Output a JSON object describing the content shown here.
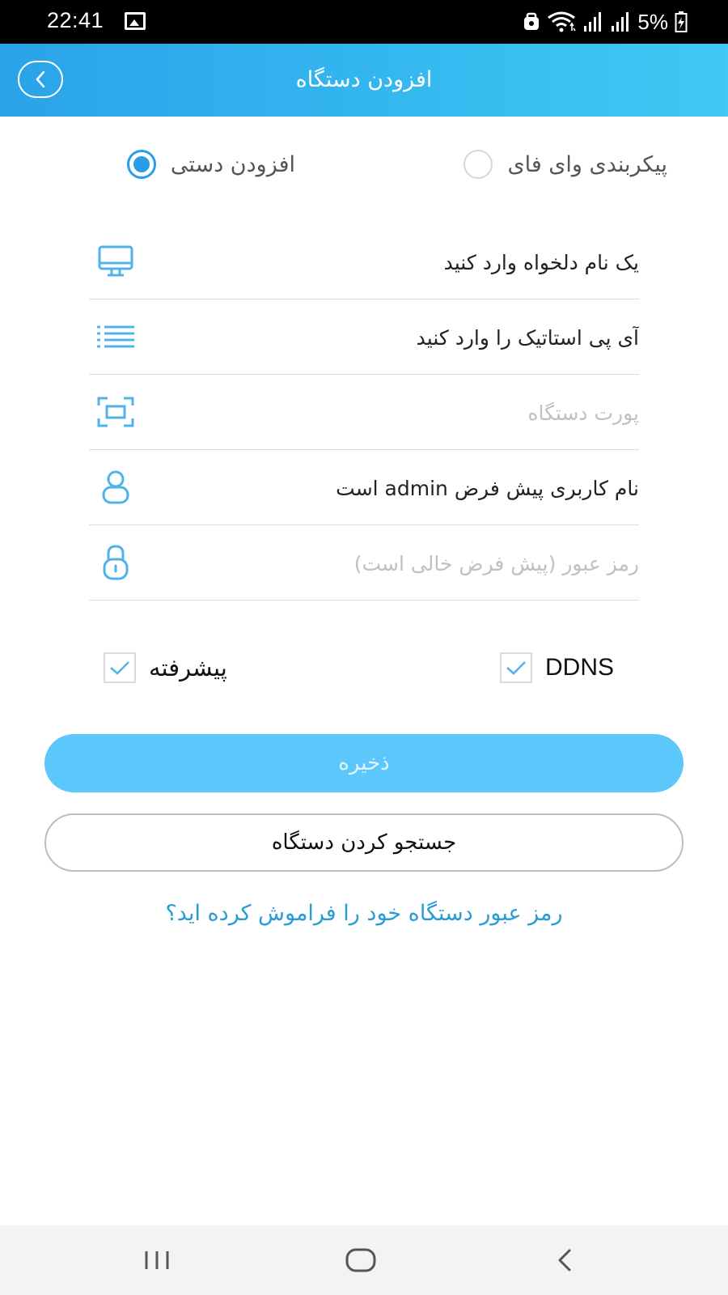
{
  "status_bar": {
    "time": "22:41",
    "battery": "5%",
    "icons": [
      "gallery-icon",
      "alarm-icon",
      "wifi-icon",
      "signal-icon",
      "signal-icon",
      "battery-charging-icon"
    ]
  },
  "header": {
    "title": "افزودن دستگاه",
    "back_icon": "chevron-left-icon"
  },
  "mode": {
    "wifi_label": "پیکربندی وای فای",
    "manual_label": "افزودن دستی",
    "selected": "manual"
  },
  "form": {
    "name_value": "یک نام دلخواه وارد کنید",
    "ip_value": "آی پی استاتیک را وارد کنید",
    "port_placeholder": "پورت دستگاه",
    "username_value": "نام کاربری پیش فرض admin است",
    "password_placeholder": "رمز عبور (پیش فرض خالی است)"
  },
  "options": {
    "ddns_label": "DDNS",
    "advanced_label": "پیشرفته"
  },
  "actions": {
    "save_label": "ذخیره",
    "search_label": "جستجو کردن دستگاه",
    "forgot_label": "رمز عبور دستگاه خود را فراموش کرده اید؟"
  },
  "colors": {
    "accent": "#2b9de4",
    "header_gradient_start": "#2aa2ea",
    "header_gradient_end": "#40c9f4",
    "save_button": "#5cc7fb",
    "link": "#2a9bd3"
  }
}
